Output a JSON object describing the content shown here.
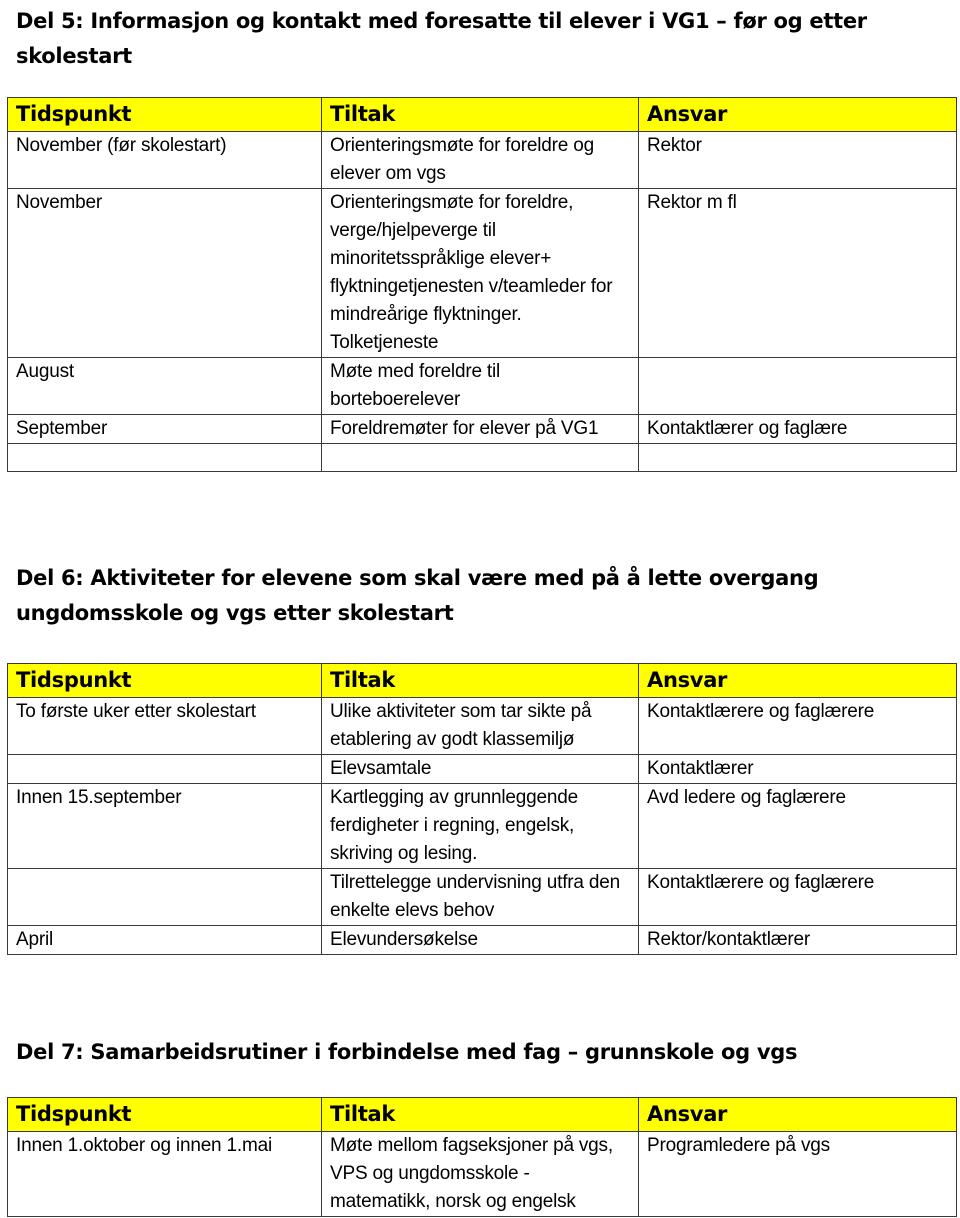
{
  "sections": [
    {
      "title": "Del 5: Informasjon og kontakt med foresatte til elever i VG1 – før og etter skolestart",
      "headers": [
        "Tidspunkt",
        "Tiltak",
        "Ansvar"
      ],
      "rows": [
        [
          "November (før skolestart)",
          "Orienteringsmøte for foreldre og elever om vgs",
          "Rektor"
        ],
        [
          "November",
          "Orienteringsmøte for foreldre, verge/hjelpeverge til minoritetsspråklige elever+ flyktningetjenesten v/teamleder for mindreårige flyktninger.  Tolketjeneste",
          "Rektor m fl"
        ],
        [
          "August",
          "Møte med foreldre til borteboerelever",
          ""
        ],
        [
          "September",
          "Foreldremøter for elever på VG1",
          "Kontaktlærer og faglære"
        ],
        [
          "",
          "",
          ""
        ]
      ]
    },
    {
      "title": "Del 6: Aktiviteter for elevene som skal være med på å lette overgang ungdomsskole og vgs etter skolestart",
      "headers": [
        "Tidspunkt",
        "Tiltak",
        "Ansvar"
      ],
      "rows": [
        [
          "To første uker etter skolestart",
          "Ulike aktiviteter som tar sikte på etablering av godt klassemiljø",
          "Kontaktlærere og faglærere"
        ],
        [
          "",
          "Elevsamtale",
          "Kontaktlærer"
        ],
        [
          "Innen 15.september",
          "Kartlegging av grunnleggende ferdigheter i regning, engelsk, skriving og lesing.",
          "Avd ledere og faglærere"
        ],
        [
          "",
          "Tilrettelegge undervisning utfra den enkelte elevs behov",
          "Kontaktlærere og faglærere"
        ],
        [
          "April",
          "Elevundersøkelse",
          "Rektor/kontaktlærer"
        ]
      ]
    },
    {
      "title": "Del 7: Samarbeidsrutiner i forbindelse med fag – grunnskole og vgs",
      "headers": [
        "Tidspunkt",
        "Tiltak",
        "Ansvar"
      ],
      "rows": [
        [
          "Innen 1.oktober og innen 1.mai",
          "Møte mellom fagseksjoner på vgs, VPS og ungdomsskole  - matematikk, norsk og engelsk",
          "Programledere på vgs"
        ]
      ]
    }
  ],
  "colors": {
    "header_bg": "#ffff00",
    "border": "#3a3a3a"
  }
}
